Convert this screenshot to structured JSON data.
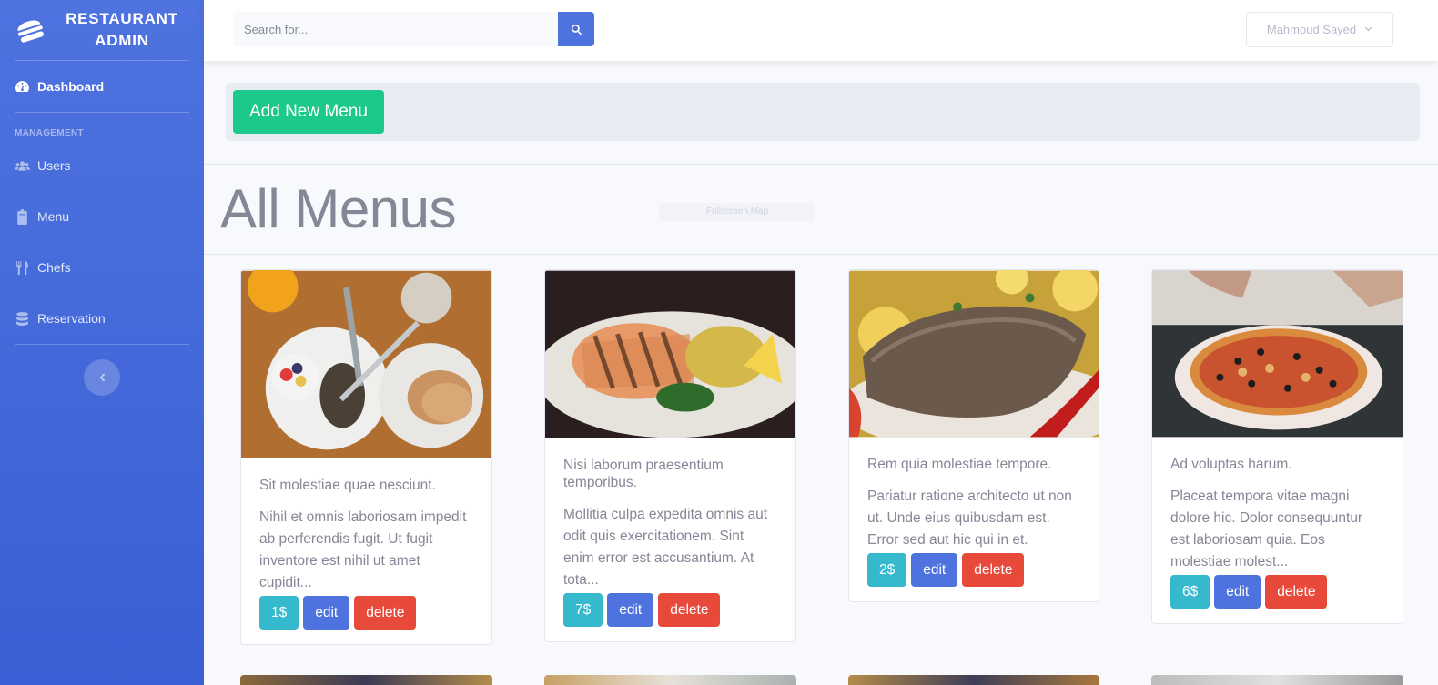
{
  "brand": {
    "line1": "RESTAURANT",
    "line2": "ADMIN"
  },
  "sidebar": {
    "dashboard": "Dashboard",
    "heading": "MANAGEMENT",
    "items": [
      {
        "label": "Users",
        "icon": "users-icon"
      },
      {
        "label": "Menu",
        "icon": "clipboard-icon"
      },
      {
        "label": "Chefs",
        "icon": "utensils-icon"
      },
      {
        "label": "Reservation",
        "icon": "database-icon"
      }
    ]
  },
  "topbar": {
    "search_placeholder": "Search for...",
    "user_name": "Mahmoud Sayed"
  },
  "actions": {
    "add_label": "Add New Menu"
  },
  "page": {
    "title": "All Menus",
    "ghost_text": "Fullscreen Map"
  },
  "cards": [
    {
      "title": "Sit molestiae quae nesciunt.",
      "text": "Nihil et omnis laboriosam impedit ab perferendis fugit. Ut fugit inventore est nihil ut amet cupidit...",
      "price": "1$",
      "edit": "edit",
      "delete": "delete"
    },
    {
      "title": "Nisi laborum praesentium temporibus.",
      "text": "Mollitia culpa expedita omnis aut odit quis exercitationem. Sint enim error est accusantium. At tota...",
      "price": "7$",
      "edit": "edit",
      "delete": "delete"
    },
    {
      "title": "Rem quia molestiae tempore.",
      "text": "Pariatur ratione architecto ut non ut. Unde eius quibusdam est. Error sed aut hic qui in et.",
      "price": "2$",
      "edit": "edit",
      "delete": "delete"
    },
    {
      "title": "Ad voluptas harum.",
      "text": "Placeat tempora vitae magni dolore hic. Dolor consequuntur est laboriosam quia. Eos molestiae molest...",
      "price": "6$",
      "edit": "edit",
      "delete": "delete"
    }
  ],
  "colors": {
    "primary": "#4e73df",
    "success": "#1cc88a",
    "info": "#36b9cc",
    "danger": "#e74a3b",
    "text": "#858796"
  }
}
